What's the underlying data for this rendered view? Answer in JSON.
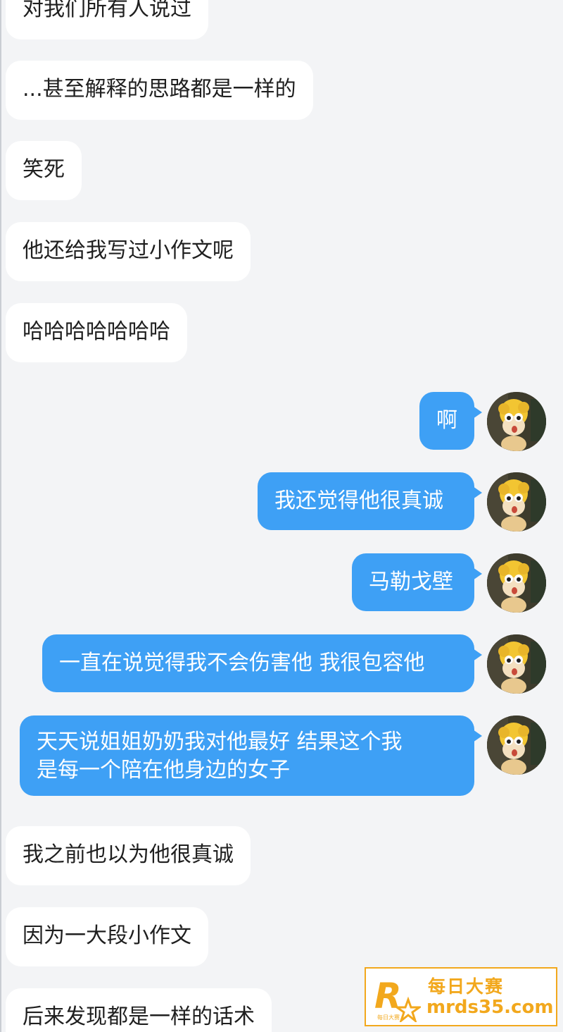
{
  "messages": [
    {
      "side": "in",
      "text": "对我们所有人说过"
    },
    {
      "side": "in",
      "text": "...甚至解释的思路都是一样的"
    },
    {
      "side": "in",
      "text": "笑死"
    },
    {
      "side": "in",
      "text": "他还给我写过小作文呢"
    },
    {
      "side": "in",
      "text": "哈哈哈哈哈哈哈"
    },
    {
      "side": "out",
      "text": "啊"
    },
    {
      "side": "out",
      "text": "我还觉得他很真诚"
    },
    {
      "side": "out",
      "text": "马勒戈壁"
    },
    {
      "side": "out",
      "text": "一直在说觉得我不会伤害他 我很包容他"
    },
    {
      "side": "out",
      "lines": [
        "天天说姐姐奶奶我对他最好 结果这个我",
        "是每一个陪在他身边的女子"
      ]
    },
    {
      "side": "in",
      "text": "我之前也以为他很真诚"
    },
    {
      "side": "in",
      "text": "因为一大段小作文"
    },
    {
      "side": "in",
      "text": "后来发现都是一样的话术"
    }
  ],
  "avatar": {
    "icon": "cartoon-avatar-icon"
  },
  "watermark": {
    "logo_letter": "R",
    "logo_small_text": "每日大赛",
    "title": "每日大赛",
    "url": "mrds35.com"
  },
  "colors": {
    "background": "#f3f4f6",
    "incoming_bubble": "#ffffff",
    "outgoing_bubble": "#3ea0f5",
    "watermark": "#f2a81d"
  }
}
